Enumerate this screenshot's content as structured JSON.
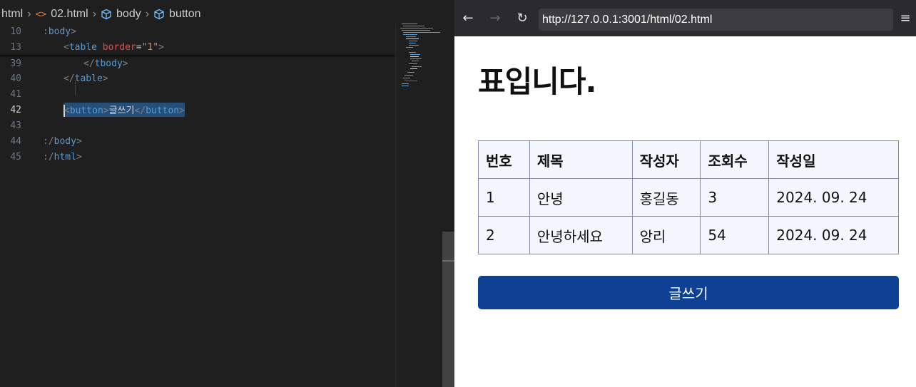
{
  "editor": {
    "breadcrumb": [
      "html",
      "02.html",
      "body",
      "button"
    ],
    "lines": [
      {
        "num": "10",
        "parts": [
          {
            "t": ":",
            "c": "punct"
          },
          {
            "t": "body",
            "c": "tag"
          },
          {
            "t": ">",
            "c": "punct"
          }
        ],
        "indent": 0
      },
      {
        "num": "13",
        "parts": [
          {
            "t": "<",
            "c": "punct"
          },
          {
            "t": "table",
            "c": "tag"
          },
          {
            "t": " ",
            "c": "punct"
          },
          {
            "t": "border",
            "c": "attr"
          },
          {
            "t": "=",
            "c": "white"
          },
          {
            "t": "\"1\"",
            "c": "val"
          },
          {
            "t": ">",
            "c": "punct"
          }
        ],
        "indent": 1
      },
      {
        "num": "39",
        "parts": [
          {
            "t": "</",
            "c": "punct"
          },
          {
            "t": "tbody",
            "c": "tag"
          },
          {
            "t": ">",
            "c": "punct"
          }
        ],
        "indent": 2
      },
      {
        "num": "40",
        "parts": [
          {
            "t": "</",
            "c": "punct"
          },
          {
            "t": "table",
            "c": "tag"
          },
          {
            "t": ">",
            "c": "punct"
          }
        ],
        "indent": 1
      },
      {
        "num": "41",
        "parts": [],
        "indent": 0
      },
      {
        "num": "42",
        "parts": [
          {
            "t": "<",
            "c": "punct"
          },
          {
            "t": "button",
            "c": "tag"
          },
          {
            "t": ">",
            "c": "punct"
          },
          {
            "t": "글쓰기",
            "c": "white"
          },
          {
            "t": "</",
            "c": "punct"
          },
          {
            "t": "button",
            "c": "tag"
          },
          {
            "t": ">",
            "c": "punct"
          }
        ],
        "indent": 1,
        "selected": true
      },
      {
        "num": "43",
        "parts": [],
        "indent": 0
      },
      {
        "num": "44",
        "parts": [
          {
            "t": ":/",
            "c": "punct"
          },
          {
            "t": "body",
            "c": "tag"
          },
          {
            "t": ">",
            "c": "punct"
          }
        ],
        "indent": 0
      },
      {
        "num": "45",
        "parts": [
          {
            "t": ":/",
            "c": "punct"
          },
          {
            "t": "html",
            "c": "tag"
          },
          {
            "t": ">",
            "c": "punct"
          }
        ],
        "indent": 0
      }
    ],
    "active_line": "42"
  },
  "browser": {
    "url": "http://127.0.0.1:3001/html/02.html",
    "back_icon": "arrow-left-icon",
    "forward_icon": "arrow-right-icon",
    "reload_icon": "reload-icon",
    "menu_icon": "hamburger-menu-icon"
  },
  "page": {
    "title": "표입니다.",
    "table": {
      "headers": [
        "번호",
        "제목",
        "작성자",
        "조회수",
        "작성일"
      ],
      "rows": [
        [
          "1",
          "안녕",
          "홍길동",
          "3",
          "2024. 09. 24"
        ],
        [
          "2",
          "안녕하세요",
          "앙리",
          "54",
          "2024. 09. 24"
        ]
      ]
    },
    "write_button": "글쓰기"
  },
  "colors": {
    "button_bg": "#0e4193",
    "table_bg": "#f3f6fd",
    "editor_bg": "#1f1f1f",
    "toolbar_bg": "#2b2b2d"
  }
}
